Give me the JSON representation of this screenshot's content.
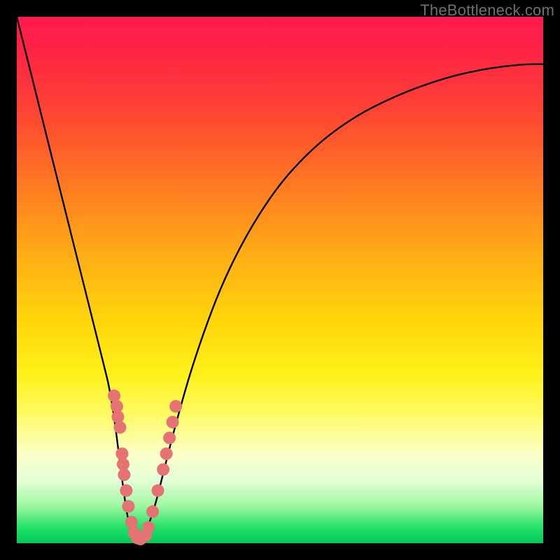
{
  "watermark": "TheBottleneck.com",
  "chart_data": {
    "type": "line",
    "title": "",
    "xlabel": "",
    "ylabel": "",
    "xlim": [
      0,
      100
    ],
    "ylim": [
      0,
      100
    ],
    "series": [
      {
        "name": "bottleneck-curve",
        "x": [
          0,
          2,
          4,
          6,
          8,
          10,
          12,
          14,
          16,
          18,
          20,
          21,
          22,
          23,
          24,
          26,
          28,
          30,
          34,
          40,
          48,
          56,
          64,
          72,
          80,
          88,
          96,
          100
        ],
        "values": [
          100,
          92,
          84,
          76,
          68,
          60,
          52,
          44,
          36,
          28,
          12,
          5,
          1,
          0,
          1,
          6,
          14,
          22,
          36,
          52,
          66,
          75,
          81,
          85,
          88,
          90,
          91,
          91
        ]
      }
    ],
    "marker_clusters": [
      {
        "name": "left-dots",
        "points": [
          {
            "x": 18.5,
            "y": 28
          },
          {
            "x": 19.0,
            "y": 26
          },
          {
            "x": 19.2,
            "y": 24
          },
          {
            "x": 19.6,
            "y": 22
          },
          {
            "x": 20.0,
            "y": 17
          },
          {
            "x": 20.2,
            "y": 15
          },
          {
            "x": 20.4,
            "y": 13
          },
          {
            "x": 20.8,
            "y": 10
          },
          {
            "x": 21.2,
            "y": 7
          },
          {
            "x": 21.8,
            "y": 4
          },
          {
            "x": 22.3,
            "y": 2
          },
          {
            "x": 22.9,
            "y": 1
          },
          {
            "x": 23.5,
            "y": 0.8
          }
        ]
      },
      {
        "name": "right-dots",
        "points": [
          {
            "x": 24.5,
            "y": 1.5
          },
          {
            "x": 25.0,
            "y": 3
          },
          {
            "x": 25.8,
            "y": 6
          },
          {
            "x": 26.8,
            "y": 10
          },
          {
            "x": 27.8,
            "y": 14
          },
          {
            "x": 28.4,
            "y": 17
          },
          {
            "x": 29.0,
            "y": 20
          },
          {
            "x": 29.6,
            "y": 23
          },
          {
            "x": 30.2,
            "y": 26
          }
        ]
      }
    ],
    "colors": {
      "curve": "#000000",
      "dot_fill": "#e57373",
      "dot_stroke": "#c85a5a",
      "gradient_top": "#ff1a4d",
      "gradient_bottom": "#00c85a"
    }
  }
}
